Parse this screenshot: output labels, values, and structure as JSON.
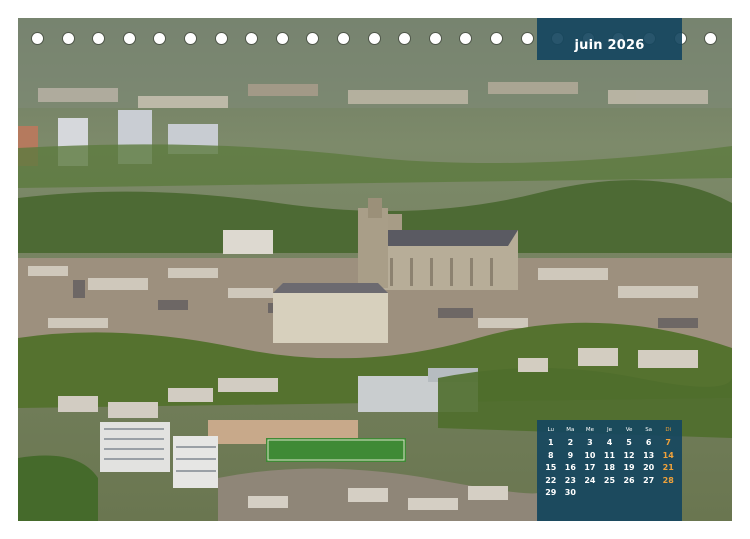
{
  "calendar_page": {
    "month_label": "juin 2026",
    "weekday_headers": [
      "Lu",
      "Ma",
      "Me",
      "Je",
      "Ve",
      "Sa",
      "Di"
    ],
    "leading_blanks": 0,
    "days": [
      "1",
      "2",
      "3",
      "4",
      "5",
      "6",
      "7",
      "8",
      "9",
      "10",
      "11",
      "12",
      "13",
      "14",
      "15",
      "16",
      "17",
      "18",
      "19",
      "20",
      "21",
      "22",
      "23",
      "24",
      "25",
      "26",
      "27",
      "28",
      "29",
      "30"
    ],
    "colors": {
      "panel": "#16465f",
      "day_text": "#ffffff",
      "sunday_text": "#f0a23a",
      "ring": "#ffffff"
    },
    "ring_count": 23,
    "photo_subject": "aerial-city-view-with-cathedral"
  }
}
